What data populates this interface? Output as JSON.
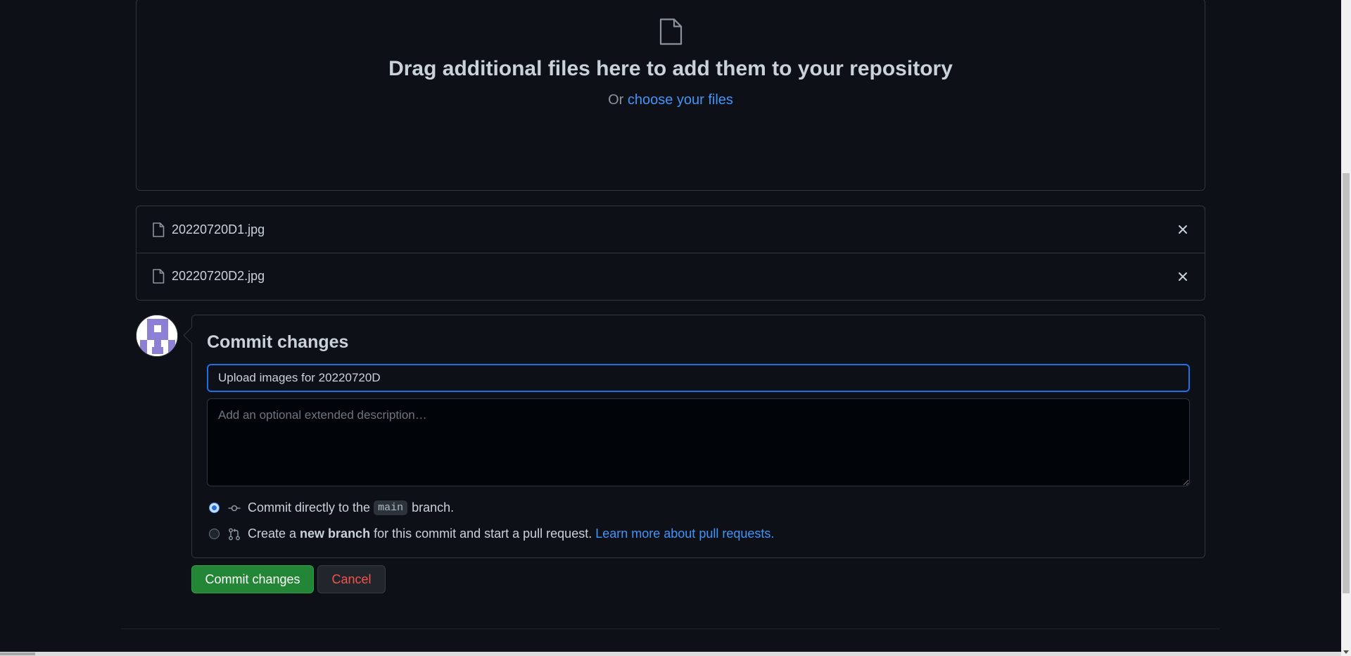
{
  "dropzone": {
    "heading": "Drag additional files here to add them to your repository",
    "or_text": "Or",
    "choose_link": "choose your files"
  },
  "files": [
    {
      "name": "20220720D1.jpg",
      "icon": "file-icon"
    },
    {
      "name": "20220720D2.jpg",
      "icon": "file-icon"
    }
  ],
  "commit": {
    "title": "Commit changes",
    "summary_value": "Upload images for 20220720D",
    "description_placeholder": "Add an optional extended description…",
    "option_direct": {
      "before": "Commit directly to the",
      "branch": "main",
      "after": "branch.",
      "checked": true
    },
    "option_new_branch": {
      "before": "Create a",
      "bold": "new branch",
      "after": "for this commit and start a pull request.",
      "link": "Learn more about pull requests.",
      "checked": false
    },
    "commit_button": "Commit changes",
    "cancel_button": "Cancel"
  },
  "colors": {
    "background": "#0d1117",
    "border": "#30363d",
    "link": "#4493f8",
    "primary_button": "#238636",
    "danger_text": "#f85149"
  }
}
